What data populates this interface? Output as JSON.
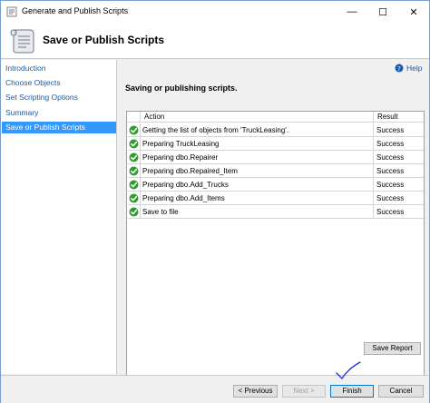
{
  "window": {
    "title": "Generate and Publish Scripts",
    "controls": {
      "minimize": "—",
      "maximize": "☐",
      "close": "✕"
    }
  },
  "header": {
    "title": "Save or Publish Scripts",
    "icon": "scroll-icon"
  },
  "nav": {
    "items": [
      {
        "label": "Introduction",
        "active": false
      },
      {
        "label": "Choose Objects",
        "active": false
      },
      {
        "label": "Set Scripting Options",
        "active": false
      },
      {
        "label": "Summary",
        "active": false
      },
      {
        "label": "Save or Publish Scripts",
        "active": true
      }
    ]
  },
  "main": {
    "help_label": "Help",
    "status": "Saving or publishing scripts.",
    "columns": {
      "action": "Action",
      "result": "Result"
    },
    "rows": [
      {
        "action": "Getting the list of objects from 'TruckLeasing'.",
        "result": "Success"
      },
      {
        "action": "Preparing TruckLeasing",
        "result": "Success"
      },
      {
        "action": "Preparing dbo.Repairer",
        "result": "Success"
      },
      {
        "action": "Preparing dbo.Repaired_Item",
        "result": "Success"
      },
      {
        "action": "Preparing dbo.Add_Trucks",
        "result": "Success"
      },
      {
        "action": "Preparing dbo.Add_Items",
        "result": "Success"
      },
      {
        "action": "Save to file",
        "result": "Success"
      }
    ],
    "save_report_label": "Save Report"
  },
  "footer": {
    "previous_label": "< Previous",
    "next_label": "Next >",
    "finish_label": "Finish",
    "cancel_label": "Cancel"
  },
  "colors": {
    "accent": "#3399ff",
    "link": "#1a5aa6",
    "success": "#2e9d2e",
    "annotation": "#1f2fd6"
  }
}
